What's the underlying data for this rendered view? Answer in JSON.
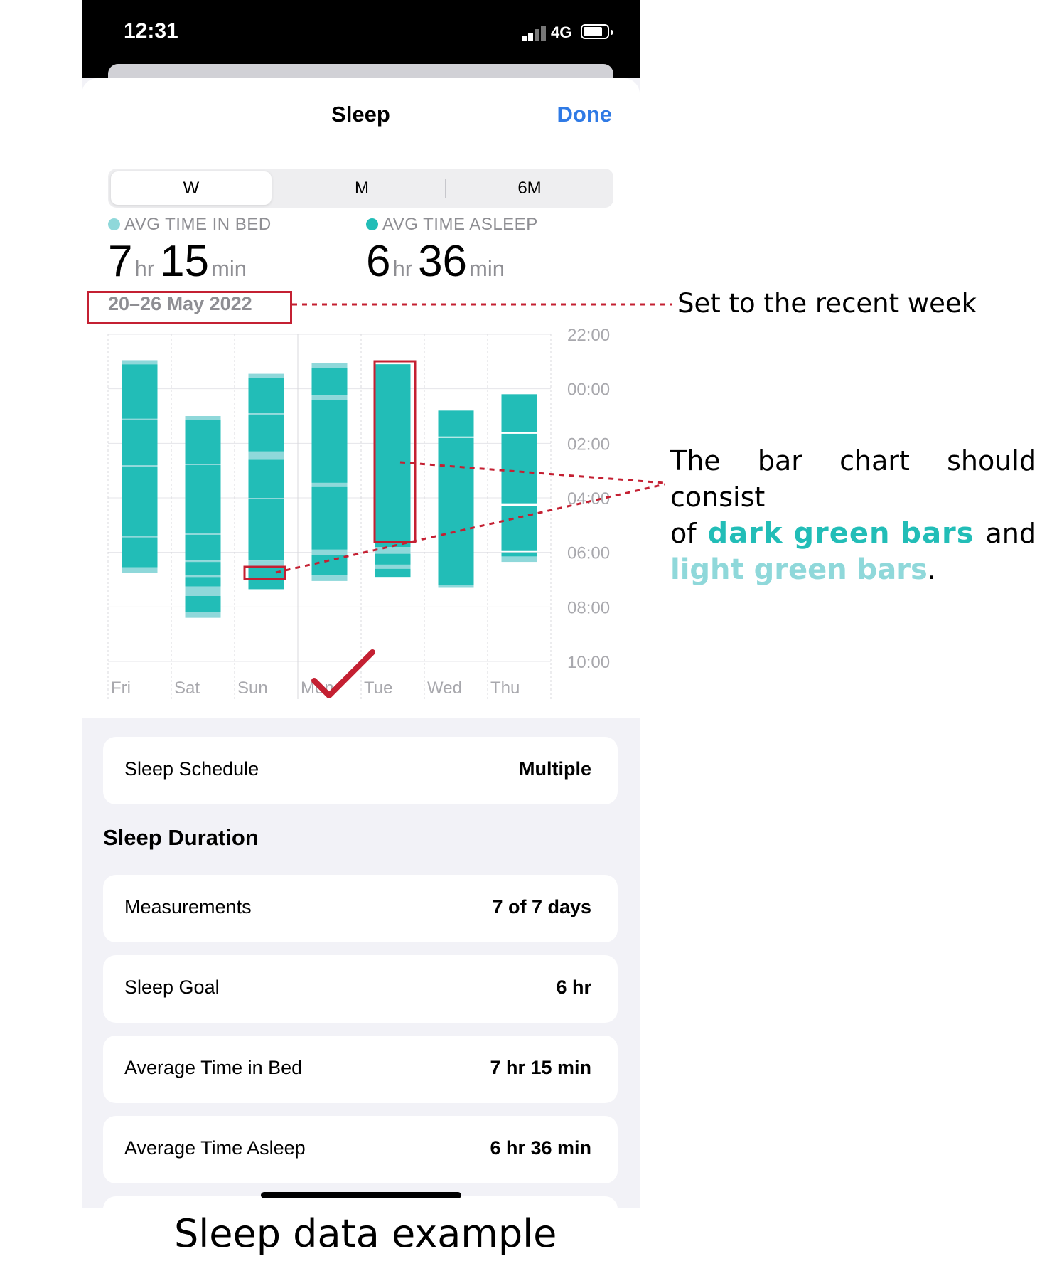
{
  "status_bar": {
    "time": "12:31",
    "network": "4G"
  },
  "nav": {
    "title": "Sleep",
    "done_label": "Done"
  },
  "segments": [
    "W",
    "M",
    "6M"
  ],
  "selected_segment": "W",
  "stats": {
    "in_bed": {
      "label": "AVG TIME IN BED",
      "hours": "7",
      "hr_unit": "hr",
      "minutes": "15",
      "min_unit": "min"
    },
    "asleep": {
      "label": "AVG TIME ASLEEP",
      "hours": "6",
      "hr_unit": "hr",
      "minutes": "36",
      "min_unit": "min"
    }
  },
  "date_range": "20–26 May 2022",
  "colors": {
    "dark_green": "#22bdb7",
    "light_green": "#8fd8da",
    "accent_blue": "#2f7ae5",
    "annotation_red": "#c42032"
  },
  "chart_data": {
    "type": "bar",
    "categories": [
      "Fri",
      "Sat",
      "Sun",
      "Mon",
      "Tue",
      "Wed",
      "Thu"
    ],
    "y_tick_labels": [
      "22:00",
      "00:00",
      "02:00",
      "04:00",
      "06:00",
      "08:00",
      "10:00"
    ],
    "y_unit": "hours after 22:00",
    "ylim": [
      0,
      12
    ],
    "series": [
      {
        "name": "dark",
        "segments": [
          [
            [
              1.1,
              3.1
            ],
            [
              3.15,
              4.8
            ],
            [
              4.85,
              7.4
            ],
            [
              7.45,
              8.55
            ]
          ],
          [
            [
              3.15,
              4.75
            ],
            [
              4.8,
              7.3
            ],
            [
              7.35,
              8.3
            ],
            [
              8.35,
              8.85
            ],
            [
              8.9,
              9.25
            ],
            [
              9.6,
              10.2
            ]
          ],
          [
            [
              1.6,
              2.9
            ],
            [
              2.95,
              4.3
            ],
            [
              4.6,
              6.0
            ],
            [
              6.05,
              8.3
            ],
            [
              8.55,
              9.35
            ]
          ],
          [
            [
              1.25,
              2.25
            ],
            [
              2.4,
              5.45
            ],
            [
              5.6,
              7.9
            ],
            [
              8.1,
              8.85
            ]
          ],
          [
            [
              1.1,
              7.8
            ],
            [
              8.05,
              8.45
            ],
            [
              8.6,
              8.9
            ]
          ],
          [
            [
              2.8,
              3.75
            ],
            [
              3.8,
              9.2
            ]
          ],
          [
            [
              2.2,
              3.6
            ],
            [
              3.65,
              6.2
            ],
            [
              6.3,
              7.95
            ],
            [
              8.0,
              8.15
            ]
          ]
        ]
      },
      {
        "name": "light",
        "segments": [
          [
            [
              0.95,
              1.1
            ],
            [
              3.1,
              3.15
            ],
            [
              4.8,
              4.85
            ],
            [
              7.4,
              7.45
            ],
            [
              8.55,
              8.75
            ]
          ],
          [
            [
              3.0,
              3.15
            ],
            [
              4.75,
              4.8
            ],
            [
              7.3,
              7.35
            ],
            [
              8.3,
              8.35
            ],
            [
              8.85,
              8.9
            ],
            [
              9.25,
              9.6
            ],
            [
              10.2,
              10.4
            ]
          ],
          [
            [
              1.45,
              1.6
            ],
            [
              2.9,
              2.95
            ],
            [
              4.3,
              4.6
            ],
            [
              6.0,
              6.05
            ],
            [
              8.3,
              8.55
            ]
          ],
          [
            [
              1.05,
              1.25
            ],
            [
              2.25,
              2.4
            ],
            [
              5.45,
              5.6
            ],
            [
              7.9,
              8.1
            ],
            [
              8.85,
              9.05
            ]
          ],
          [
            [
              7.8,
              8.05
            ],
            [
              8.45,
              8.6
            ]
          ],
          [
            [
              9.2,
              9.3
            ]
          ],
          [
            [
              8.15,
              8.35
            ]
          ]
        ]
      }
    ],
    "grid": true,
    "legend": "top-left"
  },
  "rows": {
    "schedule": {
      "label": "Sleep Schedule",
      "value": "Multiple"
    },
    "section_title": "Sleep Duration",
    "measurements": {
      "label": "Measurements",
      "value": "7 of 7 days"
    },
    "goal": {
      "label": "Sleep Goal",
      "value": "6 hr"
    },
    "avg_bed": {
      "label": "Average Time in Bed",
      "value": "7 hr 15 min"
    },
    "avg_asleep": {
      "label": "Average Time Asleep",
      "value": "6 hr 36 min"
    }
  },
  "annotations": {
    "week_note": "Set to the recent week",
    "bar_note_line1": "The bar chart should consist",
    "bar_note_of": "of",
    "bar_note_dark": "dark green bars",
    "bar_note_and": "and",
    "bar_note_light": "light green bars",
    "bar_note_period": ".",
    "caption": "Sleep data example"
  }
}
